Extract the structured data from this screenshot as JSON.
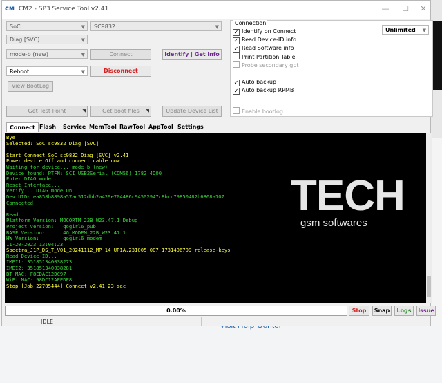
{
  "background": {
    "help_link": "Visit Help Center"
  },
  "window": {
    "title": "CM2 - SP3 Service Tool v2.41",
    "app_icon": "cm2-logo-icon"
  },
  "controls": {
    "soc_select": "SoC",
    "chip_select": "SC9832",
    "mode_select": "Diag [SVC]",
    "boot_mode_select": "mode-b (new)",
    "connect_button": "Connect",
    "identify_button": "Identify | Get info",
    "reboot_select": "Reboot",
    "disconnect_button": "Disconnect",
    "view_bootlog_button": "View BootLog",
    "get_test_point_button": "Get Test Point",
    "get_boot_files_button": "Get boot files",
    "update_device_list_button": "Update Device List"
  },
  "connection": {
    "label": "Connection",
    "speed_select": "Unlimited",
    "options": [
      {
        "label": "Identify on Connect",
        "checked": true,
        "enabled": true
      },
      {
        "label": "Read Device-ID info",
        "checked": true,
        "enabled": true
      },
      {
        "label": "Read Software info",
        "checked": true,
        "enabled": true
      },
      {
        "label": "Print Partition Table",
        "checked": false,
        "enabled": true
      },
      {
        "label": "Probe secondary gpt",
        "checked": false,
        "enabled": false
      },
      {
        "label": "Auto backup",
        "checked": true,
        "enabled": true
      },
      {
        "label": "Auto backup RPMB",
        "checked": true,
        "enabled": true
      },
      {
        "label": "Enable bootlog",
        "checked": false,
        "enabled": false
      }
    ]
  },
  "tabs": [
    "Connect",
    "Flash",
    "Service",
    "MemTool",
    "RawTool",
    "AppTool",
    "Settings"
  ],
  "log": [
    {
      "text": "Bye",
      "color": "yellow"
    },
    {
      "text": "Selected: SoC sc9832 Diag [SVC]",
      "color": "yellow"
    },
    {
      "text": "",
      "color": "green"
    },
    {
      "text": "Start Connect SoC sc9832 Diag [SVC] v2.41",
      "color": "yellow"
    },
    {
      "text": "Power device Off and connect cable now",
      "color": "yellow"
    },
    {
      "text": "Waiting for device... mode-b (new)",
      "color": "green"
    },
    {
      "text": "Device found: PTFN: SCI USB2Serial (COM56) 1782:4D00",
      "color": "green"
    },
    {
      "text": "Enter DIAG mode...",
      "color": "green"
    },
    {
      "text": "Reset Interface...",
      "color": "green"
    },
    {
      "text": "Verify... DIAG mode On",
      "color": "green"
    },
    {
      "text": "Dev UID: ea858b8898a57ac512dbb2a429e704486c94502947c8bcc79850482b6868a107",
      "color": "green"
    },
    {
      "text": "Connected",
      "color": "green"
    },
    {
      "text": "",
      "color": "green"
    },
    {
      "text": "Read...",
      "color": "green"
    },
    {
      "text": "Platform Version: MOCORTM_22B_W23.47.1_Debug",
      "color": "green"
    },
    {
      "text": "Project Version:   qogirl6_pub",
      "color": "green"
    },
    {
      "text": "BASE Version:      4G_MODEM_22B_W23.47.1",
      "color": "green"
    },
    {
      "text": "HW Version:        qogirl6_modem",
      "color": "green"
    },
    {
      "text": "11-20-2023 13:04:23",
      "color": "green"
    },
    {
      "text": "Spectra_J1P_DS_T_V01_20241112_MP 14 UP1A.231005.007 1731406709 release-keys",
      "color": "yellow"
    },
    {
      "text": "Read Device-ID...",
      "color": "green"
    },
    {
      "text": "IMEI1: 351851340038273",
      "color": "green"
    },
    {
      "text": "IMEI2: 351851340038281",
      "color": "green"
    },
    {
      "text": "BT MAC: F8EDAE12DC97",
      "color": "green"
    },
    {
      "text": "WiFi MAC: 98DC12AEEDF8",
      "color": "green"
    },
    {
      "text": "Stop [Job 22705444] Connect v2.41 23 sec",
      "color": "yellow"
    }
  ],
  "watermark": {
    "title": "TECH",
    "subtitle": "gsm softwares"
  },
  "progress": {
    "value": 0.0,
    "label": "0.00%"
  },
  "actions": {
    "stop": "Stop",
    "snap": "Snap",
    "logs": "Logs",
    "issue": "Issue"
  },
  "status": {
    "state": "IDLE"
  },
  "colors": {
    "log_background": "#000000",
    "log_green": "#39d639",
    "log_yellow": "#ffff3a",
    "stop_red": "#d42020",
    "logs_green": "#1e8a1e",
    "issue_purple": "#7a2a8a",
    "identify_purple": "#6a2a8a",
    "disconnect_red": "#d42020"
  }
}
